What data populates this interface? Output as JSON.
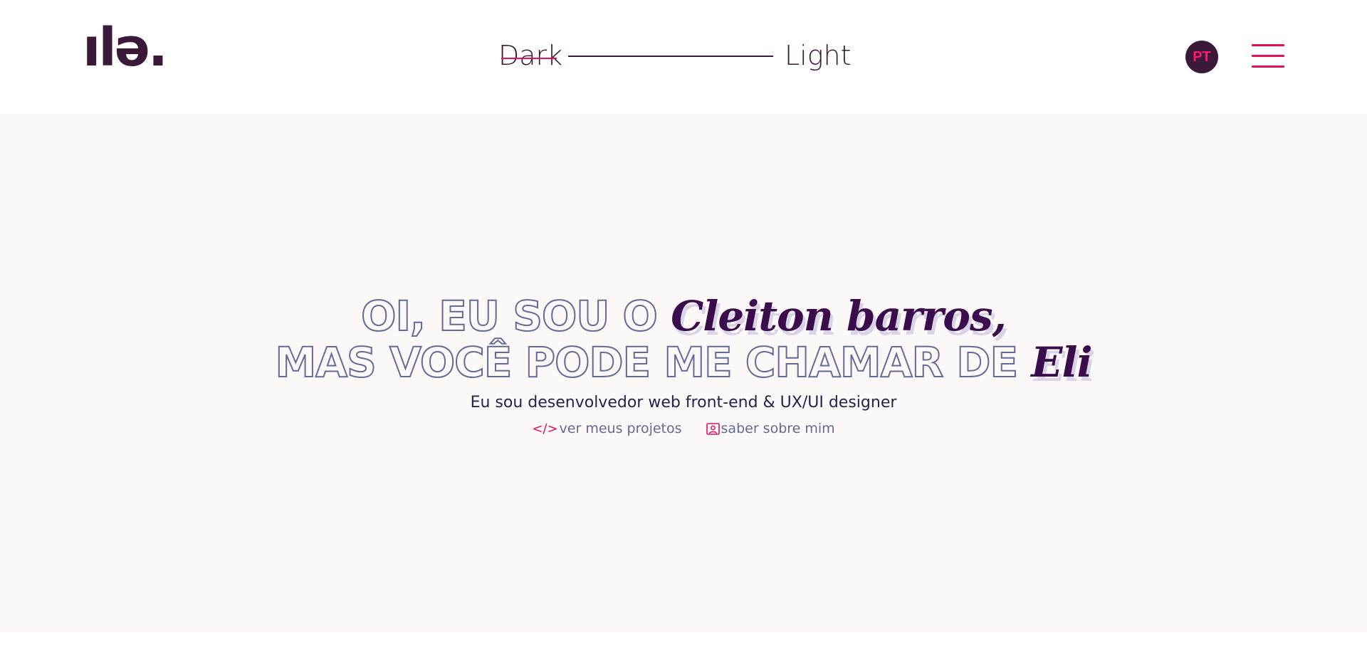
{
  "header": {
    "logo": "ılə.",
    "theme": {
      "dark_label": "Dark",
      "light_label": "Light"
    },
    "language_button": "PT",
    "menu_icon": "hamburger-menu-icon"
  },
  "hero": {
    "line1_outline": "OI, EU SOU O ",
    "line1_script": "Cleiton barros,",
    "line2_outline": "MAS VOCÊ PODE ME CHAMAR DE ",
    "line2_script": "Eli",
    "subtitle": "Eu sou desenvolvedor web front-end & UX/UI designer",
    "links": [
      {
        "icon": "code-icon",
        "icon_glyph": "</>",
        "label": "ver meus projetos"
      },
      {
        "icon": "user-card-icon",
        "label": "saber sobre mim"
      }
    ]
  },
  "colors": {
    "accent": "#e0105a",
    "dark": "#3a1a38",
    "outline_text": "#646b94",
    "script_text": "#3c0d4c",
    "hero_bg": "#fcf8f8"
  }
}
